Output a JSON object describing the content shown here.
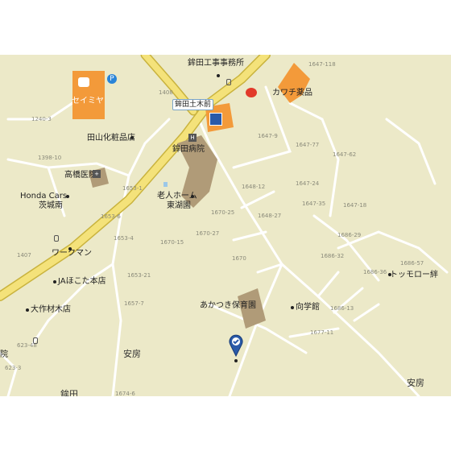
{
  "poi": {
    "seimiya": "セイミヤ",
    "kawachi": "カワチ薬品",
    "hokota_doboku": "鉾田工事事務所",
    "hokota_dobokumae": "鉾田土木前",
    "taguchi_cosme": "田山化粧品店",
    "hokota_hospital": "鉾田病院",
    "takahashi_clinic": "高橋医院",
    "honda_cars": "Honda Cars",
    "honda_cars_2": "茨城南",
    "nursing_home_1": "老人ホーム",
    "nursing_home_2": "東湖園",
    "workman": "ワークマン",
    "ja": "JAほこた本店",
    "ohsaku": "大作材木店",
    "akatsuki": "あかつき保育園",
    "kogakkan": "向学館",
    "tokkoro": "トッモロー絆"
  },
  "areas": {
    "yasufusa_1": "安房",
    "yasufusa_2": "安房",
    "hokota": "鉾田"
  },
  "addresses": [
    {
      "id": "a1647_118",
      "text": "1647-118"
    },
    {
      "id": "a1408",
      "text": "1408"
    },
    {
      "id": "a1240_3",
      "text": "1240-3"
    },
    {
      "id": "a1647_9",
      "text": "1647-9"
    },
    {
      "id": "a1647_77",
      "text": "1647-77"
    },
    {
      "id": "a1647_62",
      "text": "1647-62"
    },
    {
      "id": "a1398_10",
      "text": "1398-10"
    },
    {
      "id": "a1653_1",
      "text": "1653-1"
    },
    {
      "id": "a1648_12",
      "text": "1648-12"
    },
    {
      "id": "a1647_24",
      "text": "1647-24"
    },
    {
      "id": "a1647_35",
      "text": "1647-35"
    },
    {
      "id": "a1647_18",
      "text": "1647-18"
    },
    {
      "id": "a1653_6",
      "text": "1653-6"
    },
    {
      "id": "a1670_25",
      "text": "1670-25"
    },
    {
      "id": "a1648_27",
      "text": "1648-27"
    },
    {
      "id": "a1653_4",
      "text": "1653-4"
    },
    {
      "id": "a1670_27",
      "text": "1670-27"
    },
    {
      "id": "a1670_15",
      "text": "1670-15"
    },
    {
      "id": "a1686_29",
      "text": "1686-29"
    },
    {
      "id": "a1686_32",
      "text": "1686-32"
    },
    {
      "id": "a1407",
      "text": "1407"
    },
    {
      "id": "a1670",
      "text": "1670"
    },
    {
      "id": "a1686_57",
      "text": "1686-57"
    },
    {
      "id": "a1686_36",
      "text": "1686-36"
    },
    {
      "id": "a1653_21",
      "text": "1653-21"
    },
    {
      "id": "a1657_7",
      "text": "1657-7"
    },
    {
      "id": "a1686_13",
      "text": "1686-13"
    },
    {
      "id": "a1677_11",
      "text": "1677-11"
    },
    {
      "id": "a623_48",
      "text": "623-48"
    },
    {
      "id": "a623_3",
      "text": "623-3"
    },
    {
      "id": "a1674_6",
      "text": "1674-6"
    }
  ],
  "partial": {
    "in_clip": "院"
  },
  "colors": {
    "map_bg": "#ece9c8",
    "main_road": "#f4e27a",
    "main_road_edge": "#c9b33e",
    "minor_road": "#ffffff",
    "store_orange": "#f39a3a",
    "building": "#b09b78",
    "pin": "#2a5aa8"
  },
  "icons": [
    "shopping-bag-icon",
    "parking-icon",
    "bank-icon",
    "post-office-icon",
    "hospital-icon",
    "building-icon",
    "location-pin-icon",
    "gas-station-icon",
    "school-icon"
  ]
}
